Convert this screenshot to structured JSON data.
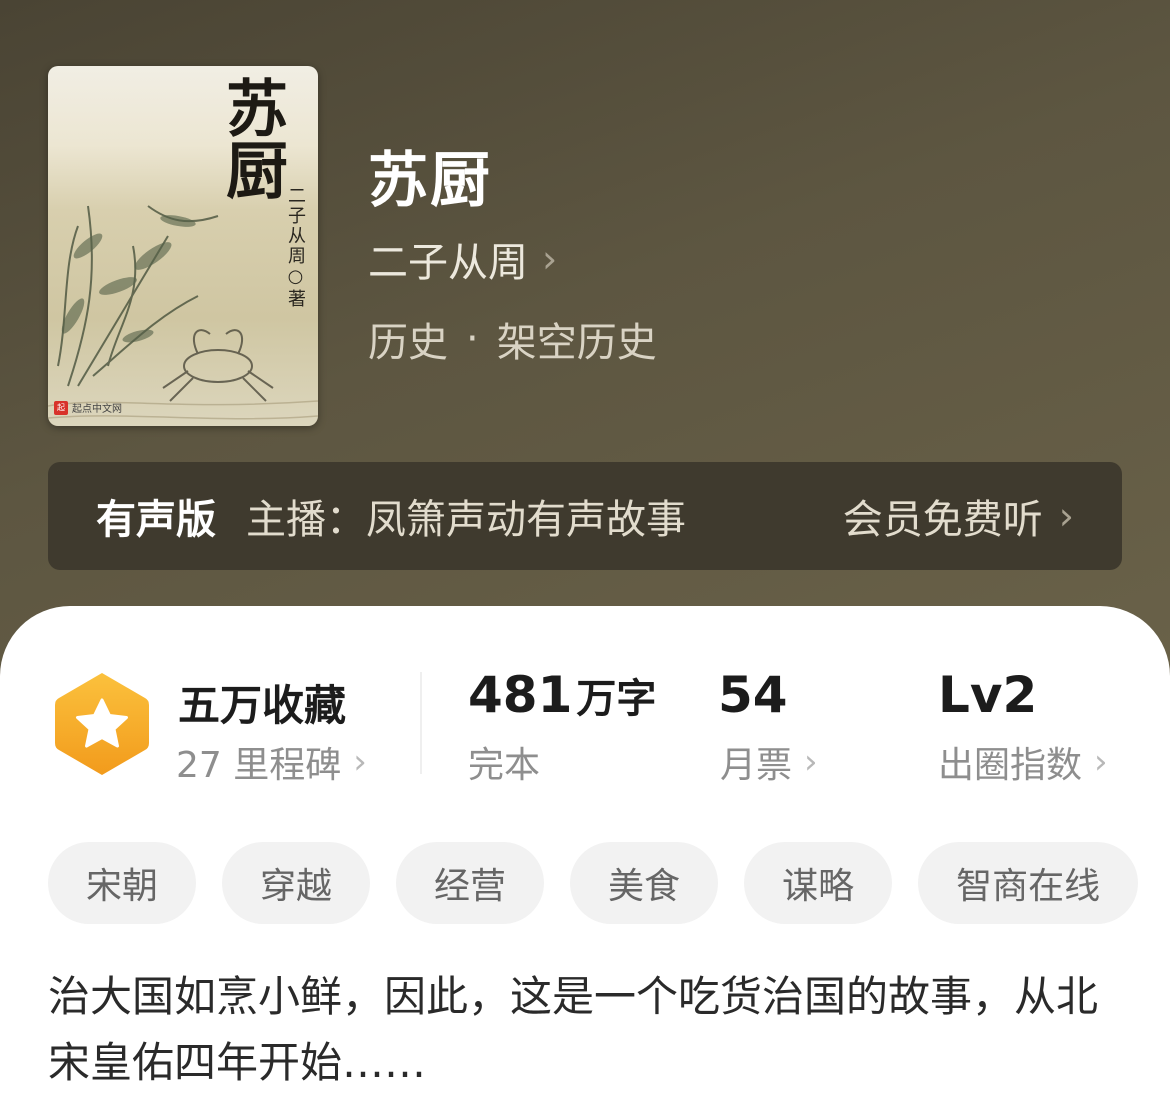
{
  "cover": {
    "title": "苏厨",
    "author_vertical": "二子从周○著",
    "publisher": "起点中文网",
    "publisher_mark": "起"
  },
  "book": {
    "title": "苏厨",
    "author": "二子从周",
    "category": "历史",
    "subcategory": "架空历史",
    "separator": "·"
  },
  "audio": {
    "label": "有声版",
    "host": "主播：凤箫声动有声故事",
    "action": "会员免费听"
  },
  "stats": {
    "collect": {
      "main": "五万收藏",
      "sub": "27 里程碑"
    },
    "words": {
      "number": "481",
      "unit": "万字",
      "sub": "完本"
    },
    "tickets": {
      "number": "54",
      "sub": "月票"
    },
    "index": {
      "number": "Lv2",
      "sub": "出圈指数"
    }
  },
  "tags": [
    "宋朝",
    "穿越",
    "经营",
    "美食",
    "谋略",
    "智商在线"
  ],
  "description": "治大国如烹小鲜，因此，这是一个吃货治国的故事，从北宋皇佑四年开始……",
  "icons": {
    "chevron": "›",
    "badge": "star-hexagon-icon"
  },
  "colors": {
    "header_bg": "#5b5440",
    "audio_bg": "#3f3a2e",
    "badge_orange": "#f5a623",
    "text_dark": "#1c1c1c",
    "text_gray": "#8e8e8e",
    "tag_bg": "#f2f2f2"
  }
}
